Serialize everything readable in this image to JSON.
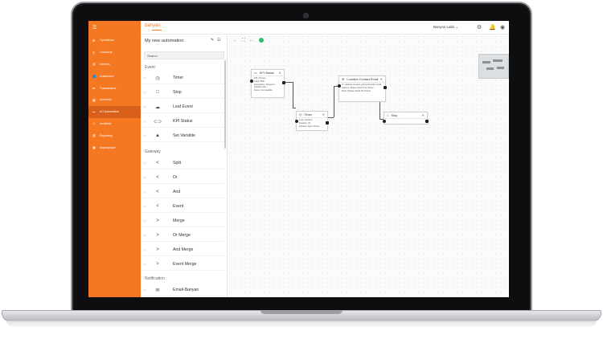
{
  "app": {
    "logo": "banyan",
    "org": "Banyan Labs",
    "icons": [
      "gear-icon",
      "bell-icon",
      "account-icon"
    ]
  },
  "sidebar": {
    "items": [
      {
        "label": "Operations",
        "icon": "grid-icon"
      },
      {
        "label": "Locations",
        "icon": "pin-icon"
      },
      {
        "label": "Devices",
        "icon": "device-icon"
      },
      {
        "label": "Customers",
        "icon": "people-icon"
      },
      {
        "label": "Transactions",
        "icon": "swap-icon"
      },
      {
        "label": "Inventory",
        "icon": "box-icon"
      },
      {
        "label": "IoT Automation",
        "icon": "flow-icon",
        "active": true
      },
      {
        "label": "Incidents",
        "icon": "alert-icon"
      },
      {
        "label": "Reporting",
        "icon": "chart-icon"
      },
      {
        "label": "Marketplace",
        "icon": "store-icon"
      }
    ]
  },
  "palette": {
    "title": "My new automation",
    "search_placeholder": "Search",
    "sections": {
      "event": "Event",
      "gateway": "Gateway",
      "notification": "Notification"
    },
    "event_items": [
      {
        "label": "Timer",
        "icon": "clock-icon"
      },
      {
        "label": "Stop",
        "icon": "square-icon"
      },
      {
        "label": "Leaf Event",
        "icon": "leaf-icon"
      },
      {
        "label": "KPI Status",
        "icon": "toggle-icon"
      },
      {
        "label": "Set Variable",
        "icon": "flask-icon"
      }
    ],
    "gateway_items": [
      {
        "label": "Split",
        "icon": "split-icon"
      },
      {
        "label": "Or",
        "icon": "split-icon"
      },
      {
        "label": "And",
        "icon": "split-icon"
      },
      {
        "label": "Event",
        "icon": "split-icon"
      },
      {
        "label": "Merge",
        "icon": "merge-icon"
      },
      {
        "label": "Or Merge",
        "icon": "merge-icon"
      },
      {
        "label": "And Merge",
        "icon": "merge-icon"
      },
      {
        "label": "Event Merge",
        "icon": "merge-icon"
      }
    ],
    "notification_items": [
      {
        "label": "Email-Banyan",
        "icon": "mail-icon"
      }
    ]
  },
  "canvas": {
    "nodes": {
      "kpi_status": {
        "title": "KPI Status",
        "lines": [
          "KPI: Primary",
          "Label: Bulk",
          "Expectation: Stopped > Product Labs",
          "Name: Comparable"
        ]
      },
      "location_contact_email": {
        "title": "Location Contact Email",
        "lines": [
          "To: Address location.getInputContact.email",
          "Subject: Please Check The Printer",
          "Body: Please Check the Printer"
        ]
      },
      "timer": {
        "title": "Timer",
        "lines": [
          "Type: Duration",
          "Duration: 30",
          "Duration Type: Minute"
        ]
      },
      "stop": {
        "title": "Stop",
        "lines": []
      }
    }
  }
}
